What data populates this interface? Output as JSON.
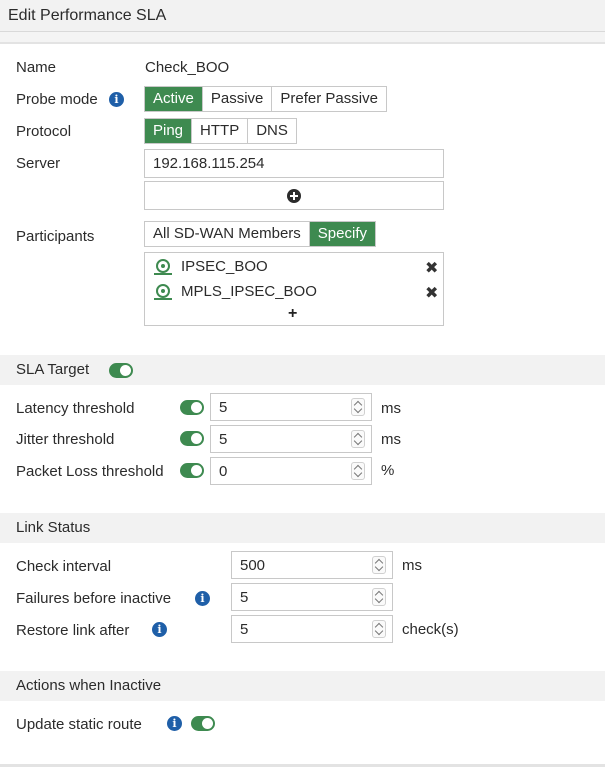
{
  "header": {
    "title": "Edit Performance SLA"
  },
  "form": {
    "name_label": "Name",
    "name_value": "Check_BOO",
    "probe_mode_label": "Probe mode",
    "probe_modes": [
      "Active",
      "Passive",
      "Prefer Passive"
    ],
    "probe_mode_selected": "Active",
    "protocol_label": "Protocol",
    "protocols": [
      "Ping",
      "HTTP",
      "DNS"
    ],
    "protocol_selected": "Ping",
    "server_label": "Server",
    "server_value": "192.168.115.254",
    "server_extra_value": "",
    "participants_label": "Participants",
    "participant_modes": [
      "All SD-WAN Members",
      "Specify"
    ],
    "participant_mode_selected": "Specify",
    "members": [
      "IPSEC_BOO",
      "MPLS_IPSEC_BOO"
    ]
  },
  "sla": {
    "section_title": "SLA Target",
    "section_enabled": true,
    "latency_label": "Latency threshold",
    "latency_value": "5",
    "latency_unit": "ms",
    "jitter_label": "Jitter threshold",
    "jitter_value": "5",
    "jitter_unit": "ms",
    "loss_label": "Packet Loss threshold",
    "loss_value": "0",
    "loss_unit": "%"
  },
  "link": {
    "section_title": "Link Status",
    "check_interval_label": "Check interval",
    "check_interval_value": "500",
    "check_interval_unit": "ms",
    "failures_label": "Failures before inactive",
    "failures_value": "5",
    "restore_label": "Restore link after",
    "restore_value": "5",
    "restore_unit": "check(s)"
  },
  "actions": {
    "section_title": "Actions when Inactive",
    "update_route_label": "Update static route",
    "update_route_enabled": true
  },
  "colors": {
    "accent": "#3e8a50",
    "info": "#1f5fa8",
    "section_bg": "#f2f2f2"
  },
  "icons": [
    "info-icon",
    "add-circle-icon",
    "member-interface-icon",
    "remove-icon",
    "add-icon",
    "spinner-icon",
    "toggle-switch"
  ]
}
